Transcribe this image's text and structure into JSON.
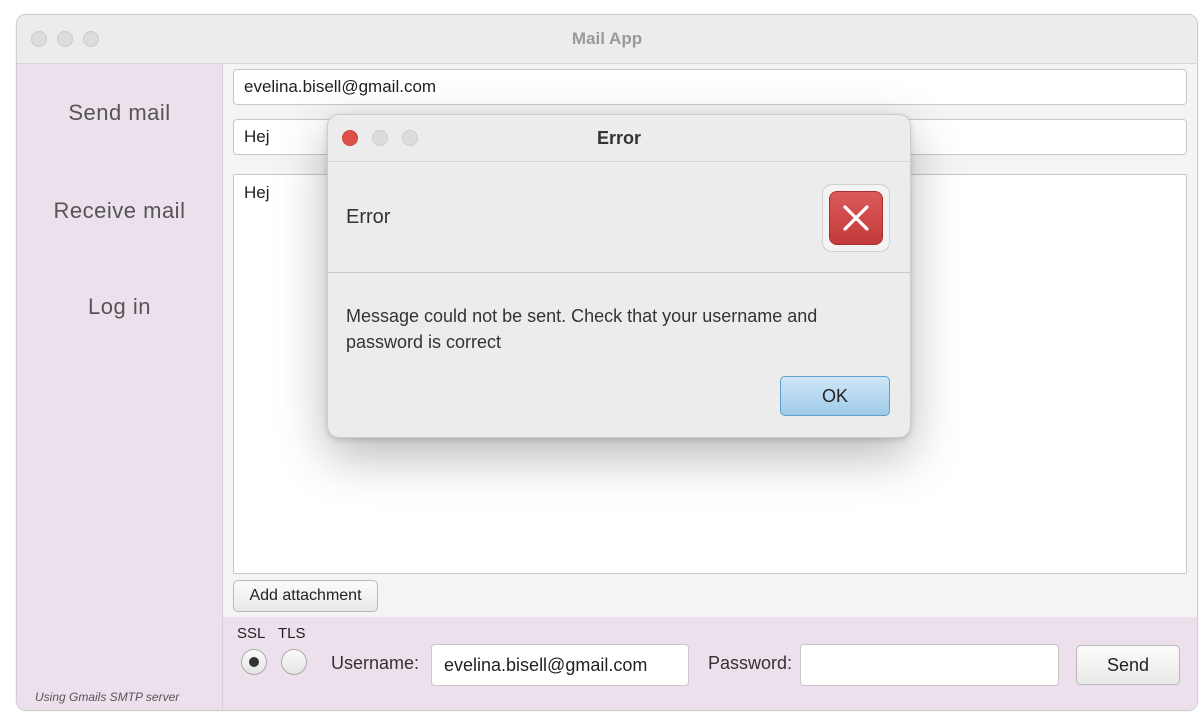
{
  "window": {
    "title": "Mail App"
  },
  "sidebar": {
    "items": [
      {
        "label": "Send mail"
      },
      {
        "label": "Receive mail"
      },
      {
        "label": "Log in"
      }
    ],
    "footnote": "Using Gmails SMTP server"
  },
  "compose": {
    "to": "evelina.bisell@gmail.com",
    "subject": "Hej",
    "body": "Hej",
    "add_attachment_label": "Add attachment"
  },
  "bottombar": {
    "ssl_label": "SSL",
    "tls_label": "TLS",
    "selected_protocol": "SSL",
    "username_label": "Username:",
    "username_value": "evelina.bisell@gmail.com",
    "password_label": "Password:",
    "password_value": "",
    "send_label": "Send"
  },
  "dialog": {
    "title": "Error",
    "header": "Error",
    "message": "Message could not be sent. Check that your username and password is correct",
    "ok_label": "OK",
    "close_color": "#e0504a"
  }
}
